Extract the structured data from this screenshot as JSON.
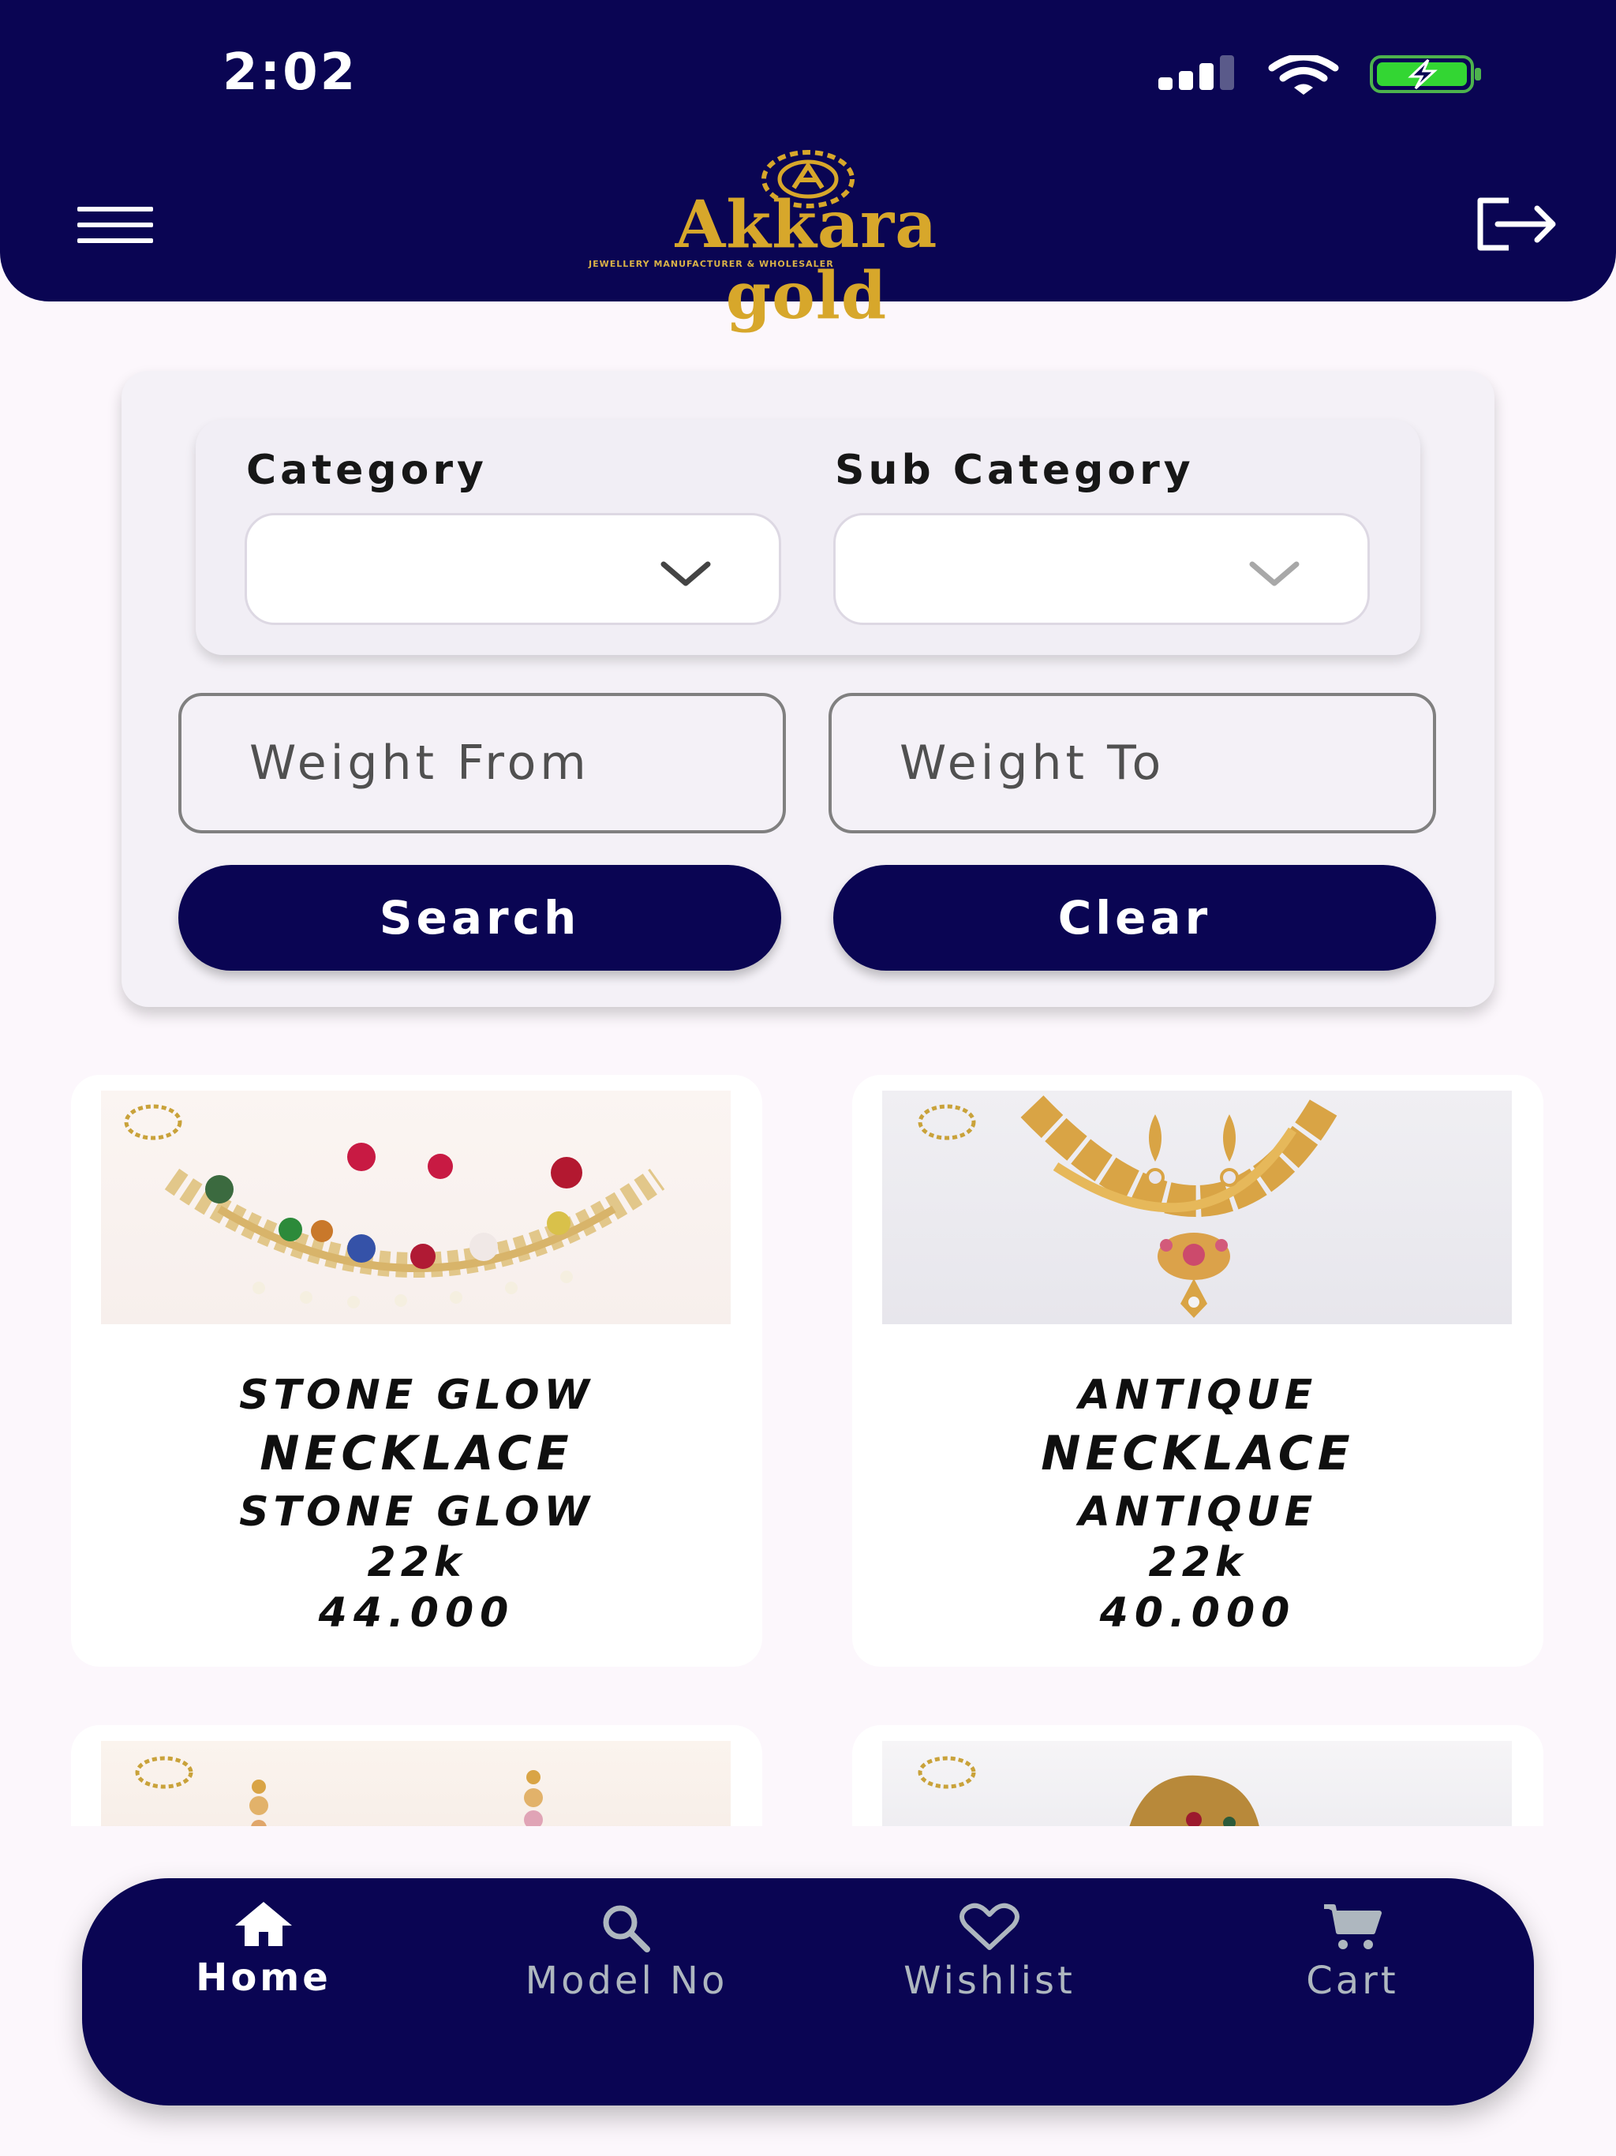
{
  "status_bar": {
    "time": "2:02",
    "signal_icon": "cellular-signal-icon",
    "wifi_icon": "wifi-icon",
    "battery_icon": "battery-charging-icon"
  },
  "header": {
    "menu_icon": "hamburger-menu-icon",
    "logo_text": "Akkara gold",
    "logo_tagline": "JEWELLERY MANUFACTURER & WHOLESALER",
    "logout_icon": "logout-icon",
    "background_color": "#0a0553",
    "brand_gold": "#d7a72b"
  },
  "filters": {
    "category_label": "Category",
    "category_value": "",
    "subcategory_label": "Sub Category",
    "subcategory_value": "",
    "weight_from_placeholder": "Weight From",
    "weight_to_placeholder": "Weight To",
    "search_label": "Search",
    "clear_label": "Clear"
  },
  "products": [
    {
      "name": "STONE GLOW",
      "type": "NECKLACE",
      "subcategory": "STONE GLOW",
      "karat": "22k",
      "weight": "44.000"
    },
    {
      "name": "ANTIQUE",
      "type": "NECKLACE",
      "subcategory": "ANTIQUE",
      "karat": "22k",
      "weight": "40.000"
    }
  ],
  "bottom_nav": {
    "items": [
      {
        "label": "Home",
        "icon": "home-icon",
        "active": true
      },
      {
        "label": "Model No",
        "icon": "search-icon",
        "active": false
      },
      {
        "label": "Wishlist",
        "icon": "heart-icon",
        "active": false
      },
      {
        "label": "Cart",
        "icon": "cart-icon",
        "active": false
      }
    ]
  }
}
